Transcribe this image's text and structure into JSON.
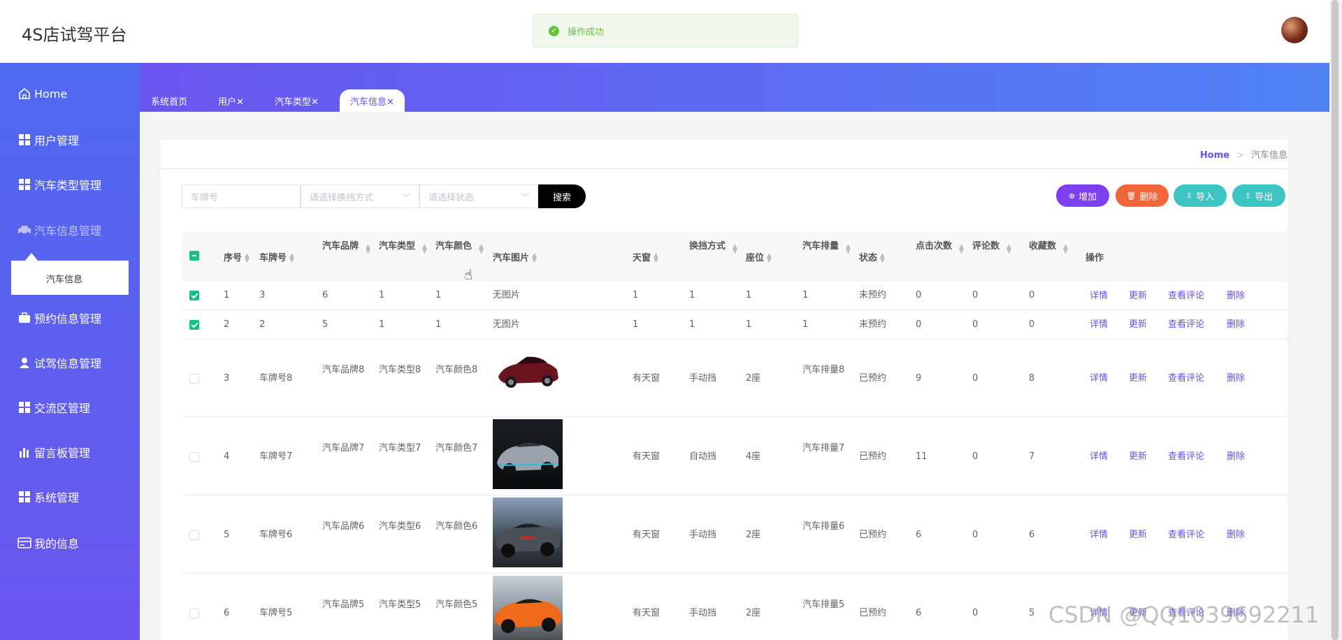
{
  "app_title": "4S店试驾平台",
  "toast": {
    "message": "操作成功",
    "icon": "success-check-icon"
  },
  "sidebar": {
    "home": "Home",
    "items": [
      {
        "label": "用户管理",
        "icon": "grid-icon"
      },
      {
        "label": "汽车类型管理",
        "icon": "grid-icon"
      },
      {
        "label": "汽车信息管理",
        "icon": "car-icon"
      },
      {
        "label": "预约信息管理",
        "icon": "briefcase-icon"
      },
      {
        "label": "试驾信息管理",
        "icon": "user-icon"
      },
      {
        "label": "交流区管理",
        "icon": "grid-icon"
      },
      {
        "label": "留言板管理",
        "icon": "bar-chart-icon"
      },
      {
        "label": "系统管理",
        "icon": "grid-icon"
      },
      {
        "label": "我的信息",
        "icon": "card-icon"
      }
    ],
    "submenu_item": "汽车信息"
  },
  "tabs": [
    {
      "label": "系统首页"
    },
    {
      "label": "用户✕"
    },
    {
      "label": "汽车类型✕"
    },
    {
      "label": "汽车信息✕"
    }
  ],
  "breadcrumb": {
    "home": "Home",
    "sep": ">",
    "current": "汽车信息"
  },
  "search": {
    "plate_placeholder": "车牌号",
    "gear_placeholder": "请选择换挡方式",
    "status_placeholder": "请选择状态",
    "button": "搜索"
  },
  "actions": {
    "add": "增加",
    "delete": "删除",
    "import": "导入",
    "export": "导出"
  },
  "table": {
    "headers": [
      "序号",
      "车牌号",
      "汽车品牌",
      "汽车类型",
      "汽车颜色",
      "汽车图片",
      "天窗",
      "换挡方式",
      "座位",
      "汽车排量",
      "状态",
      "点击次数",
      "评论数",
      "收藏数",
      "操作"
    ],
    "row_actions": [
      "详情",
      "更新",
      "查看评论",
      "删除"
    ],
    "rows": [
      {
        "checked": true,
        "idx": "1",
        "plate": "3",
        "brand": "6",
        "type": "1",
        "color": "1",
        "image": "无图片",
        "sunroof": "1",
        "gear": "1",
        "seats": "1",
        "displacement": "1",
        "status": "未预约",
        "clicks": "0",
        "comments": "0",
        "favorites": "0"
      },
      {
        "checked": true,
        "idx": "2",
        "plate": "2",
        "brand": "5",
        "type": "1",
        "color": "1",
        "image": "无图片",
        "sunroof": "1",
        "gear": "1",
        "seats": "1",
        "displacement": "1",
        "status": "未预约",
        "clicks": "0",
        "comments": "0",
        "favorites": "0"
      },
      {
        "checked": false,
        "idx": "3",
        "plate": "车牌号8",
        "brand": "汽车品牌8",
        "type": "汽车类型8",
        "color": "汽车颜色8",
        "image": "",
        "sunroof": "有天窗",
        "gear": "手动挡",
        "seats": "2座",
        "displacement": "汽车排量8",
        "status": "已预约",
        "clicks": "9",
        "comments": "0",
        "favorites": "8"
      },
      {
        "checked": false,
        "idx": "4",
        "plate": "车牌号7",
        "brand": "汽车品牌7",
        "type": "汽车类型7",
        "color": "汽车颜色7",
        "image": "",
        "sunroof": "有天窗",
        "gear": "自动挡",
        "seats": "4座",
        "displacement": "汽车排量7",
        "status": "已预约",
        "clicks": "11",
        "comments": "0",
        "favorites": "7"
      },
      {
        "checked": false,
        "idx": "5",
        "plate": "车牌号6",
        "brand": "汽车品牌6",
        "type": "汽车类型6",
        "color": "汽车颜色6",
        "image": "",
        "sunroof": "有天窗",
        "gear": "手动挡",
        "seats": "2座",
        "displacement": "汽车排量6",
        "status": "已预约",
        "clicks": "6",
        "comments": "0",
        "favorites": "6"
      },
      {
        "checked": false,
        "idx": "6",
        "plate": "车牌号5",
        "brand": "汽车品牌5",
        "type": "汽车类型5",
        "color": "汽车颜色5",
        "image": "",
        "sunroof": "有天窗",
        "gear": "手动挡",
        "seats": "2座",
        "displacement": "汽车排量5",
        "status": "已预约",
        "clicks": "6",
        "comments": "0",
        "favorites": "5"
      }
    ]
  },
  "watermark": "CSDN @QQ1039692211",
  "colors": {
    "accent": "#6b4fe8",
    "success": "#67c23a",
    "check": "#13c087",
    "add_btn": "#7d3ff0",
    "delete_btn": "#f0663a",
    "import_btn": "#3ec3c3",
    "export_btn": "#3ec3c3"
  }
}
